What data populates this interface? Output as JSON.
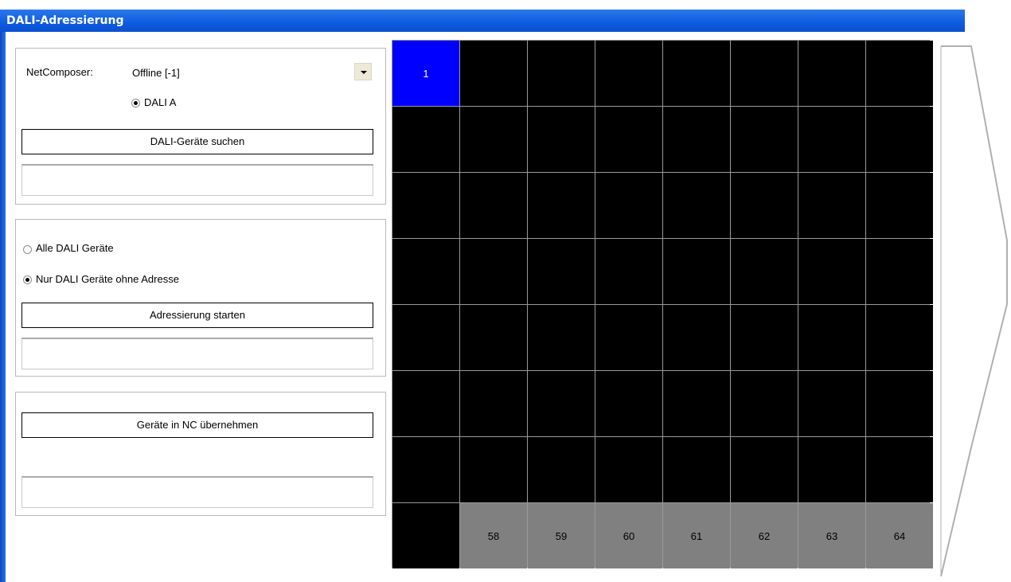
{
  "window": {
    "title": "DALI-Adressierung"
  },
  "panel1": {
    "netcomposer_label": "NetComposer:",
    "netcomposer_value": "Offline [-1]",
    "radio_label": "DALI A",
    "search_button": "DALI-Geräte suchen"
  },
  "panel2": {
    "radio_all": "Alle DALI Geräte",
    "radio_unaddressed": "Nur DALI Geräte ohne Adresse",
    "start_button": "Adressierung starten"
  },
  "panel3": {
    "apply_button": "Geräte in NC übernehmen"
  },
  "grid": {
    "rows": 8,
    "cols": 8,
    "selected_cell": {
      "label": "1",
      "color": "#0000ff"
    },
    "cell_color": "#000000",
    "numbered_color": "#808080",
    "cells": [
      "1",
      "",
      "",
      "",
      "",
      "",
      "",
      "",
      "",
      "",
      "",
      "",
      "",
      "",
      "",
      "",
      "",
      "",
      "",
      "",
      "",
      "",
      "",
      "",
      "",
      "",
      "",
      "",
      "",
      "",
      "",
      "",
      "",
      "",
      "",
      "",
      "",
      "",
      "",
      "",
      "",
      "",
      "",
      "",
      "",
      "",
      "",
      "",
      "",
      "",
      "",
      "",
      "",
      "",
      "",
      "",
      "",
      "58",
      "59",
      "60",
      "61",
      "62",
      "63",
      "64"
    ]
  },
  "colors": {
    "titlebar": "#0f5be0",
    "selected": "#0000ff",
    "grid_gray": "#808080"
  }
}
